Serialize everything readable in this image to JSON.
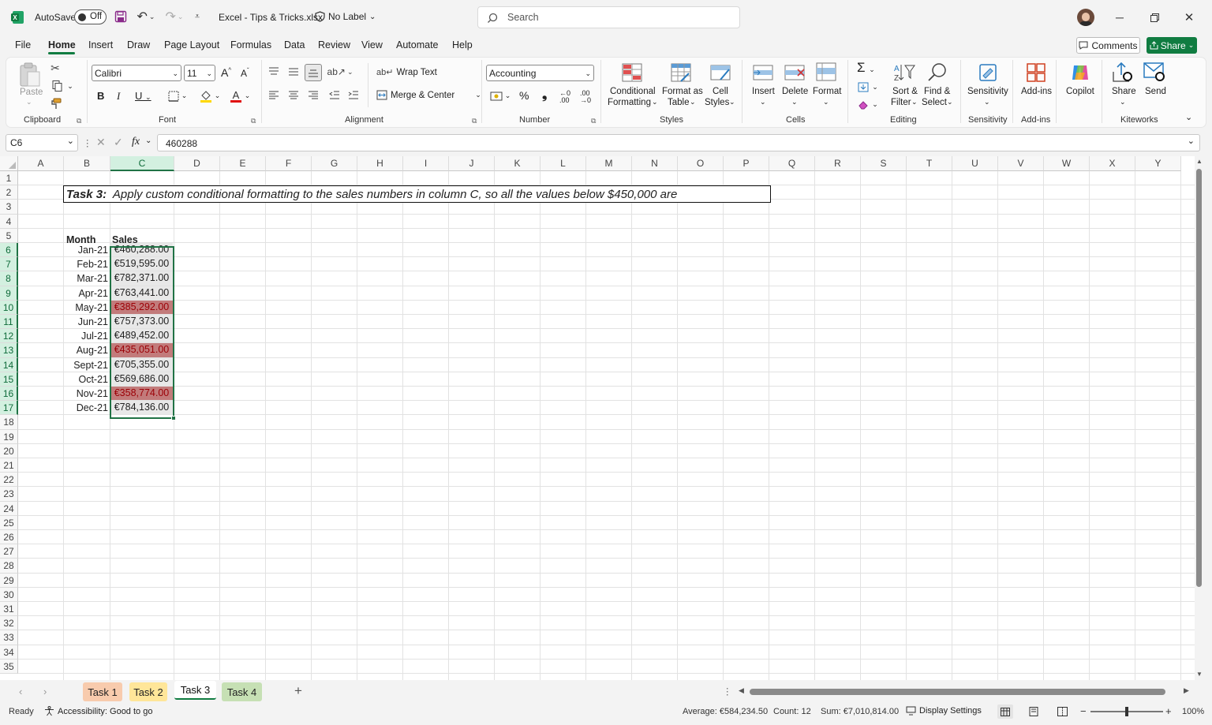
{
  "titlebar": {
    "autosave_label": "AutoSave",
    "autosave_state": "Off",
    "filename": "Excel - Tips & Tricks.xlsx",
    "label": "No Label",
    "search_placeholder": "Search"
  },
  "menu": [
    "File",
    "Home",
    "Insert",
    "Draw",
    "Page Layout",
    "Formulas",
    "Data",
    "Review",
    "View",
    "Automate",
    "Help"
  ],
  "menu_active": "Home",
  "comments_label": "Comments",
  "share_label": "Share",
  "ribbon": {
    "clipboard": {
      "paste": "Paste",
      "group": "Clipboard"
    },
    "font": {
      "name": "Calibri",
      "size": "11",
      "group": "Font"
    },
    "alignment": {
      "wrap": "Wrap Text",
      "merge": "Merge & Center",
      "group": "Alignment"
    },
    "number": {
      "format": "Accounting",
      "group": "Number"
    },
    "styles": {
      "cond1": "Conditional",
      "cond2": "Formatting",
      "fmt1": "Format as",
      "fmt2": "Table",
      "cell1": "Cell",
      "cell2": "Styles",
      "group": "Styles"
    },
    "cells": {
      "insert": "Insert",
      "delete": "Delete",
      "format": "Format",
      "group": "Cells"
    },
    "editing": {
      "sort1": "Sort &",
      "sort2": "Filter",
      "find1": "Find &",
      "find2": "Select",
      "group": "Editing"
    },
    "sensitivity": {
      "label": "Sensitivity",
      "group": "Sensitivity"
    },
    "addins": {
      "label": "Add-ins",
      "group": "Add-ins"
    },
    "copilot": {
      "label": "Copilot"
    },
    "kiteworks": {
      "share": "Share",
      "send": "Send",
      "group": "Kiteworks"
    }
  },
  "formula_bar": {
    "name_box": "C6",
    "fx": "fx",
    "value": "460288"
  },
  "columns": [
    "A",
    "B",
    "C",
    "D",
    "E",
    "F",
    "G",
    "H",
    "I",
    "J",
    "K",
    "L",
    "M",
    "N",
    "O",
    "P",
    "Q",
    "R",
    "S",
    "T",
    "U",
    "V",
    "W",
    "X",
    "Y"
  ],
  "rows": [
    "1",
    "2",
    "3",
    "4",
    "5",
    "6",
    "7",
    "8",
    "9",
    "10",
    "11",
    "12",
    "13",
    "14",
    "15",
    "16",
    "17",
    "18",
    "19",
    "20",
    "21",
    "22",
    "23",
    "24",
    "25",
    "26",
    "27",
    "28",
    "29",
    "30",
    "31",
    "32",
    "33",
    "34",
    "35"
  ],
  "task": {
    "bold": "Task 3:",
    "text": "Apply custom conditional formatting to the sales numbers in column C, so all the values below $450,000 are"
  },
  "table": {
    "header_month": "Month",
    "header_sales": "Sales",
    "rows": [
      {
        "month": "Jan-21",
        "sales": "€460,288.00",
        "low": false
      },
      {
        "month": "Feb-21",
        "sales": "€519,595.00",
        "low": false
      },
      {
        "month": "Mar-21",
        "sales": "€782,371.00",
        "low": false
      },
      {
        "month": "Apr-21",
        "sales": "€763,441.00",
        "low": false
      },
      {
        "month": "May-21",
        "sales": "€385,292.00",
        "low": true
      },
      {
        "month": "Jun-21",
        "sales": "€757,373.00",
        "low": false
      },
      {
        "month": "Jul-21",
        "sales": "€489,452.00",
        "low": false
      },
      {
        "month": "Aug-21",
        "sales": "€435,051.00",
        "low": true
      },
      {
        "month": "Sept-21",
        "sales": "€705,355.00",
        "low": false
      },
      {
        "month": "Oct-21",
        "sales": "€569,686.00",
        "low": false
      },
      {
        "month": "Nov-21",
        "sales": "€358,774.00",
        "low": true
      },
      {
        "month": "Dec-21",
        "sales": "€784,136.00",
        "low": false
      }
    ]
  },
  "sheets": [
    {
      "name": "Task 1",
      "color": "#f8cbad",
      "active": false
    },
    {
      "name": "Task 2",
      "color": "#ffe699",
      "active": false
    },
    {
      "name": "Task 3",
      "color": "#ffffff",
      "active": true
    },
    {
      "name": "Task 4",
      "color": "#c6e0b4",
      "active": false
    }
  ],
  "status": {
    "ready": "Ready",
    "accessibility": "Accessibility: Good to go",
    "average": "Average: €584,234.50",
    "count": "Count: 12",
    "sum": "Sum: €7,010,814.00",
    "display": "Display Settings",
    "zoom": "100%"
  },
  "colors": {
    "excel_green": "#107c41",
    "low_fill": "#c27b7b",
    "low_text": "#9c0006",
    "selection": "#217346"
  }
}
